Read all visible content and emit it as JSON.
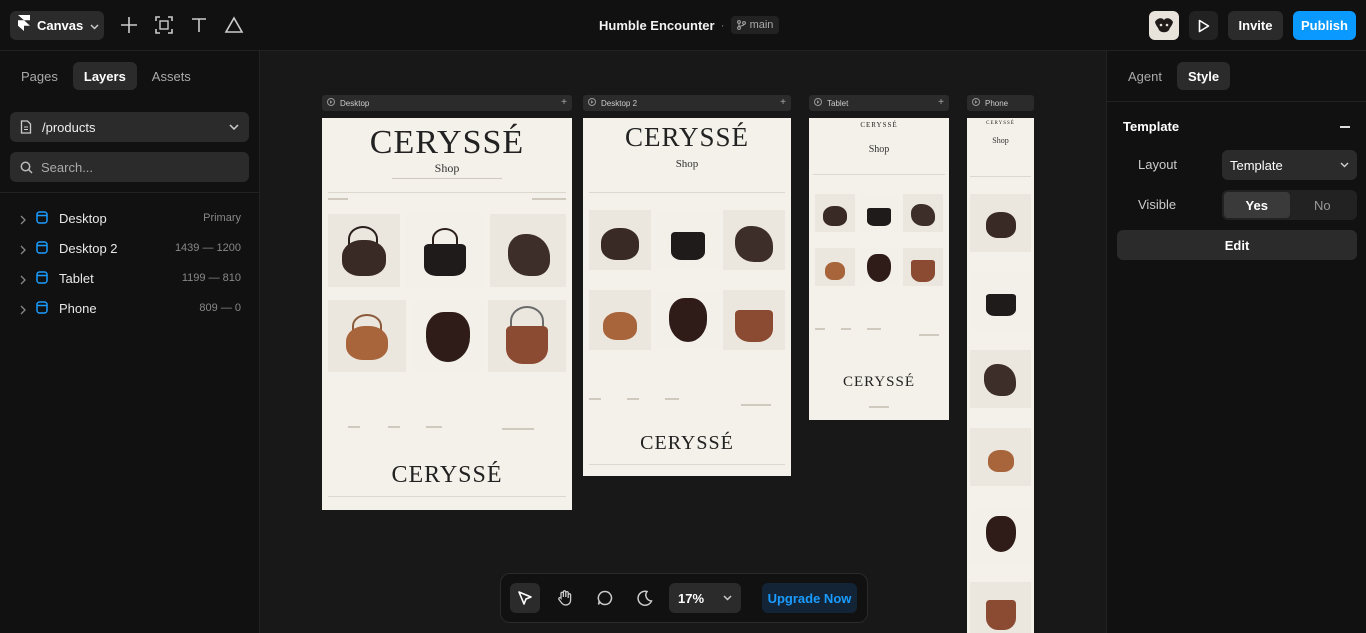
{
  "topbar": {
    "app_menu_label": "Canvas",
    "project_name": "Humble Encounter",
    "separator": "·",
    "branch": "main",
    "invite_label": "Invite",
    "publish_label": "Publish"
  },
  "left_panel": {
    "tabs": [
      {
        "label": "Pages",
        "active": false
      },
      {
        "label": "Layers",
        "active": true
      },
      {
        "label": "Assets",
        "active": false
      }
    ],
    "page_path": "/products",
    "search_placeholder": "Search...",
    "layers": [
      {
        "name": "Desktop",
        "meta": "Primary"
      },
      {
        "name": "Desktop 2",
        "meta": "1439 — 1200"
      },
      {
        "name": "Tablet",
        "meta": "1199 — 810"
      },
      {
        "name": "Phone",
        "meta": "809 — 0"
      }
    ]
  },
  "canvas": {
    "frames": [
      {
        "label": "Desktop"
      },
      {
        "label": "Desktop 2"
      },
      {
        "label": "Tablet"
      },
      {
        "label": "Phone"
      }
    ],
    "site": {
      "brand": "CERYSSÉ",
      "heading": "Shop"
    }
  },
  "bottom_toolbar": {
    "zoom": "17%",
    "upgrade_label": "Upgrade Now"
  },
  "right_panel": {
    "tabs": [
      {
        "label": "Agent",
        "active": false
      },
      {
        "label": "Style",
        "active": true
      }
    ],
    "section_title": "Template",
    "layout_label": "Layout",
    "layout_value": "Template",
    "visible_label": "Visible",
    "visible_options": [
      "Yes",
      "No"
    ],
    "visible_value": "Yes",
    "edit_label": "Edit"
  },
  "colors": {
    "accent": "#0a99ff",
    "panel": "#111111",
    "canvas": "#181818",
    "site_background": "#f4f1ea"
  }
}
